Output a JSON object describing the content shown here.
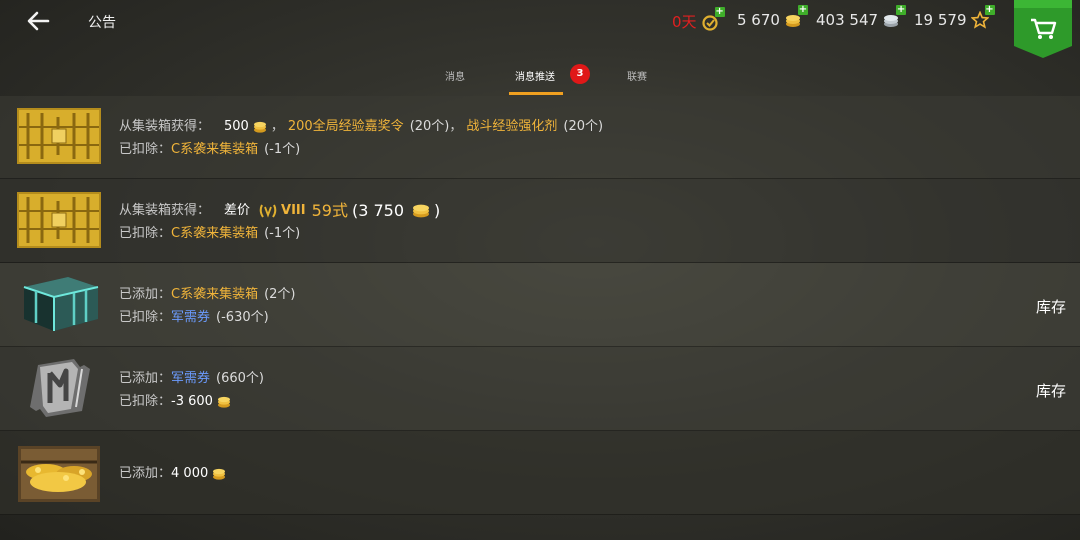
{
  "header": {
    "title": "公告",
    "currencies": {
      "premium_days": "0天",
      "gold": "5 670",
      "credits": "403 547",
      "free_xp": "19 579"
    }
  },
  "tabs": [
    {
      "label": "消息",
      "active": false
    },
    {
      "label": "消息推送",
      "active": true
    },
    {
      "label": "联赛",
      "active": false
    }
  ],
  "tab_badge": "3",
  "colors": {
    "accent": "#f0a020",
    "item": "#f0b43a",
    "link": "#6c9cff",
    "badge": "#e01818",
    "shop": "#2e9a2a"
  },
  "messages": [
    {
      "icon": "golden-container-icon",
      "line1": {
        "label": "从集装箱获得：",
        "amount": "500",
        "sep": "，",
        "item1": "200全局经验嘉奖令",
        "qty1": "(20个)",
        "sep2": "，",
        "item2": "战斗经验强化剂",
        "qty2": "(20个)"
      },
      "line2": {
        "label": "已扣除：",
        "item": "C系袭来集装箱",
        "qty": "(-1个)"
      }
    },
    {
      "icon": "golden-container-icon",
      "line1": {
        "label": "从集装箱获得：",
        "prefix": "差价",
        "tier": "VIII",
        "tank": "59式",
        "amount_open": "(3 750",
        "amount_close": ")"
      },
      "line2": {
        "label": "已扣除：",
        "item": "C系袭来集装箱",
        "qty": "(-1个)"
      }
    },
    {
      "icon": "teal-container-icon",
      "line1": {
        "label": "已添加：",
        "item": "C系袭来集装箱",
        "qty": "(2个)"
      },
      "line2": {
        "label": "已扣除：",
        "item": "军需券",
        "qty": "(-630个)"
      },
      "action": "库存"
    },
    {
      "icon": "ticket-icon",
      "line1": {
        "label": "已添加：",
        "item": "军需券",
        "qty": "(660个)"
      },
      "line2": {
        "label": "已扣除：",
        "amount": "-3 600"
      },
      "action": "库存"
    },
    {
      "icon": "gold-chest-icon",
      "line1": {
        "label": "已添加：",
        "amount": "4 000"
      }
    }
  ]
}
